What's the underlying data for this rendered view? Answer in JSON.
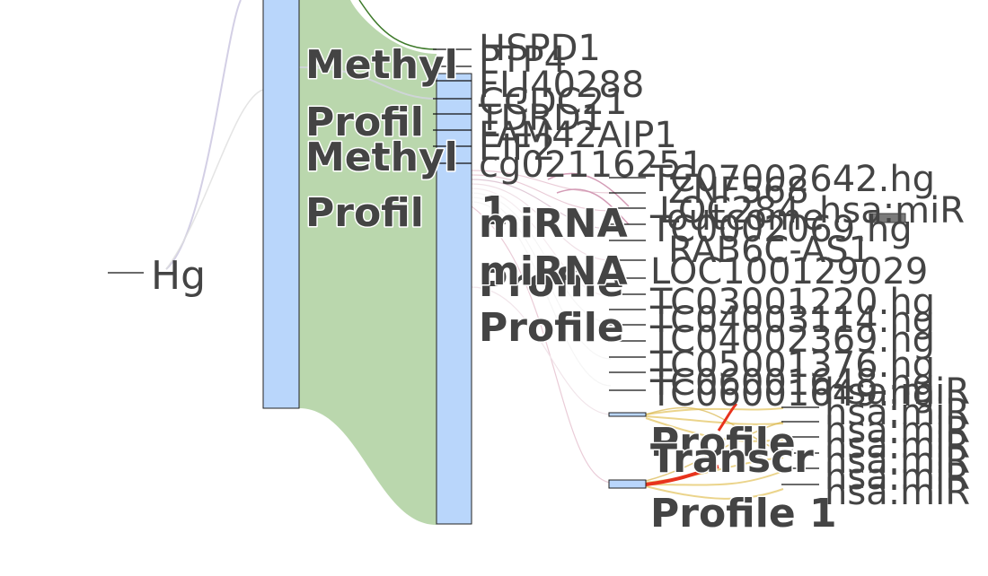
{
  "colors": {
    "node_fill": "#b9d6fb",
    "node_stroke": "#222222",
    "label": "#444444",
    "green_flow": "#a9cd98",
    "green_edge": "#3e7a2a",
    "lavender_flow": "#c8c3df",
    "pink_flow": "#d9a3b8",
    "gold_flow": "#e2c25a",
    "red_flow": "#e8331d",
    "gray_node": "#7a7a7a"
  },
  "root": {
    "label": "Hg"
  },
  "group_labels": {
    "methyl_a": "Methyl",
    "profil_a": "Profil",
    "methyl_b": "Methyl",
    "profil_b": "Profil",
    "one": "1",
    "mirna_a": "miRNA",
    "mirna_b": "miRNA",
    "profile_hidden": "Profile",
    "profile_c": "Profile",
    "profile_d": "Profile",
    "transcr": "Transcr",
    "profile_1": "Profile 1"
  },
  "genes": [
    "HSPD1",
    "PTP4",
    "FLJ40288",
    "CCDC21",
    "TDRD1",
    "FAM42AIP1",
    "EIF2",
    "cg02116251"
  ],
  "transcripts": [
    "TC07002642.hg",
    "ZNF568",
    "LOC284",
    "hsa:miR",
    "TC0002069.hg",
    "RAB6C-AS1",
    "LOC100129029",
    "TC03001220.hg",
    "TC04003114.hg",
    "TC04002369.hg",
    "TC05001376.hg",
    "TC06001648.hg",
    "TC06001649.hg"
  ],
  "outcome": {
    "label": "outcome"
  },
  "mirnas": [
    "hsa:miR",
    "hsa:miR",
    "hsa:miR",
    "hsa:miR",
    "hsa:miR",
    "hsa:miR",
    "hsa:miR"
  ]
}
